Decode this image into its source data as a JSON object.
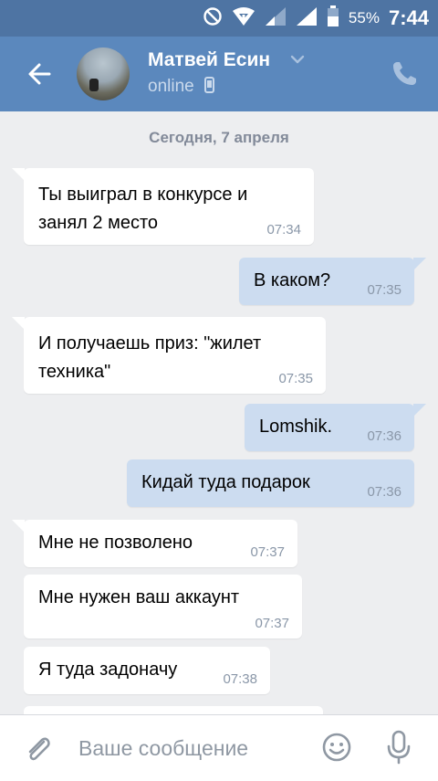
{
  "status_bar": {
    "battery_percent": "55%",
    "time": "7:44",
    "icons": [
      "do-not-disturb-icon",
      "wifi-icon",
      "signal-icon",
      "signal-icon",
      "battery-icon"
    ]
  },
  "header": {
    "contact_name": "Матвей Есин",
    "presence": "online",
    "icons": [
      "back-arrow-icon",
      "chevron-down-icon",
      "mobile-device-icon",
      "phone-icon"
    ]
  },
  "date_separator": "Сегодня, 7 апреля",
  "messages": [
    {
      "direction": "in",
      "lines": [
        "Ты выиграл в конкурсе и",
        "занял 2 место"
      ],
      "time": "07:34"
    },
    {
      "direction": "out",
      "lines": [
        "В каком?"
      ],
      "time": "07:35"
    },
    {
      "direction": "in",
      "lines": [
        "И получаешь приз: \"жилет",
        "техника\""
      ],
      "time": "07:35"
    },
    {
      "direction": "out",
      "lines": [
        "Lomshik."
      ],
      "time": "07:36"
    },
    {
      "direction": "out",
      "lines": [
        "Кидай туда подарок"
      ],
      "time": "07:36"
    },
    {
      "direction": "in",
      "lines": [
        "Мне не позволено"
      ],
      "time": "07:37"
    },
    {
      "direction": "in",
      "lines": [
        "Мне нужен ваш аккаунт"
      ],
      "time": "07:37"
    },
    {
      "direction": "in",
      "lines": [
        "Я туда задоначу"
      ],
      "time": "07:38"
    }
  ],
  "composer": {
    "placeholder": "Ваше сообщение",
    "value": "",
    "icons": [
      "attach-icon",
      "emoji-icon",
      "microphone-icon"
    ]
  },
  "colors": {
    "status_bar": "#4e74a3",
    "header": "#5b88bd",
    "background": "#edeef0",
    "incoming_bubble": "#ffffff",
    "outgoing_bubble": "#ccdcf0"
  }
}
